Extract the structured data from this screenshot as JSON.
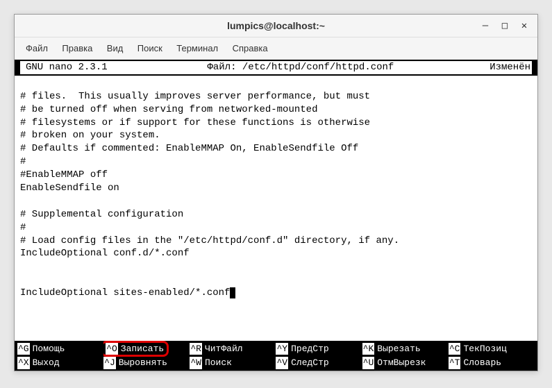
{
  "window": {
    "title": "lumpics@localhost:~"
  },
  "menubar": {
    "items": [
      "Файл",
      "Правка",
      "Вид",
      "Поиск",
      "Терминал",
      "Справка"
    ]
  },
  "nano": {
    "version": "GNU nano 2.3.1",
    "file_label": "Файл: /etc/httpd/conf/httpd.conf",
    "status": "Изменён"
  },
  "content": {
    "lines": [
      "",
      "# files.  This usually improves server performance, but must",
      "# be turned off when serving from networked-mounted",
      "# filesystems or if support for these functions is otherwise",
      "# broken on your system.",
      "# Defaults if commented: EnableMMAP On, EnableSendfile Off",
      "#",
      "#EnableMMAP off",
      "EnableSendfile on",
      "",
      "# Supplemental configuration",
      "#",
      "# Load config files in the \"/etc/httpd/conf.d\" directory, if any.",
      "IncludeOptional conf.d/*.conf",
      "",
      "",
      "IncludeOptional sites-enabled/*.conf"
    ]
  },
  "shortcuts": {
    "row1": [
      {
        "key": "^G",
        "label": "Помощь"
      },
      {
        "key": "^O",
        "label": "Записать"
      },
      {
        "key": "^R",
        "label": "ЧитФайл"
      },
      {
        "key": "^Y",
        "label": "ПредСтр"
      },
      {
        "key": "^K",
        "label": "Вырезать"
      },
      {
        "key": "^C",
        "label": "ТекПозиц"
      }
    ],
    "row2": [
      {
        "key": "^X",
        "label": "Выход"
      },
      {
        "key": "^J",
        "label": "Выровнять"
      },
      {
        "key": "^W",
        "label": "Поиск"
      },
      {
        "key": "^V",
        "label": "СледСтр"
      },
      {
        "key": "^U",
        "label": "ОтмВырезк"
      },
      {
        "key": "^T",
        "label": "Словарь"
      }
    ]
  }
}
